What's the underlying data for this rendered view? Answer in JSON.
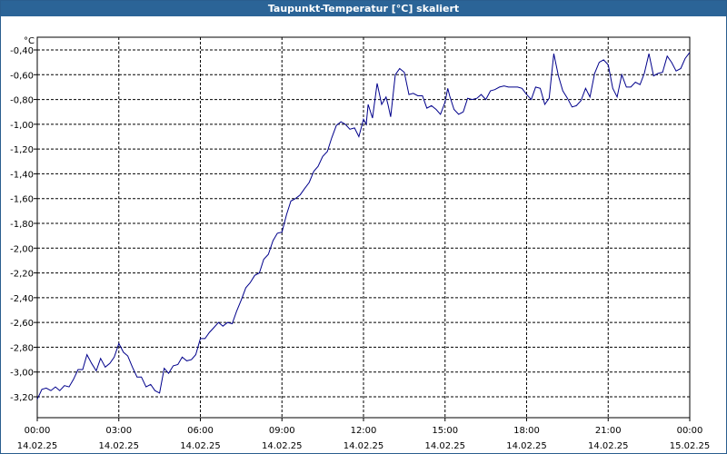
{
  "window": {
    "title": "Taupunkt-Temperatur [°C] skaliert"
  },
  "chart_data": {
    "type": "line",
    "title": "Taupunkt-Temperatur [°C] skaliert",
    "ylabel": "°C",
    "xlabel": "",
    "ylim": [
      -3.3,
      -0.3
    ],
    "xlim": [
      "14.02.25 00:00",
      "15.02.25 00:00"
    ],
    "grid": true,
    "line_color": "#00008b",
    "y_ticks": [
      "-0,40",
      "-0,60",
      "-0,80",
      "-1,00",
      "-1,20",
      "-1,40",
      "-1,60",
      "-1,80",
      "-2,00",
      "-2,20",
      "-2,40",
      "-2,60",
      "-2,80",
      "-3,00",
      "-3,20"
    ],
    "y_tick_values": [
      -0.4,
      -0.6,
      -0.8,
      -1.0,
      -1.2,
      -1.4,
      -1.6,
      -1.8,
      -2.0,
      -2.2,
      -2.4,
      -2.6,
      -2.8,
      -3.0,
      -3.2
    ],
    "x_ticks": [
      {
        "time": "00:00",
        "date": "14.02.25",
        "hour": 0
      },
      {
        "time": "03:00",
        "date": "14.02.25",
        "hour": 3
      },
      {
        "time": "06:00",
        "date": "14.02.25",
        "hour": 6
      },
      {
        "time": "09:00",
        "date": "14.02.25",
        "hour": 9
      },
      {
        "time": "12:00",
        "date": "14.02.25",
        "hour": 12
      },
      {
        "time": "15:00",
        "date": "14.02.25",
        "hour": 15
      },
      {
        "time": "18:00",
        "date": "14.02.25",
        "hour": 18
      },
      {
        "time": "21:00",
        "date": "14.02.25",
        "hour": 21
      },
      {
        "time": "00:00",
        "date": "15.02.25",
        "hour": 24
      }
    ],
    "series": [
      {
        "points": [
          [
            0.0,
            -3.22
          ],
          [
            0.17,
            -3.14
          ],
          [
            0.33,
            -3.13
          ],
          [
            0.5,
            -3.15
          ],
          [
            0.67,
            -3.12
          ],
          [
            0.83,
            -3.15
          ],
          [
            1.0,
            -3.11
          ],
          [
            1.17,
            -3.12
          ],
          [
            1.33,
            -3.06
          ],
          [
            1.5,
            -2.98
          ],
          [
            1.67,
            -2.98
          ],
          [
            1.83,
            -2.86
          ],
          [
            2.0,
            -2.93
          ],
          [
            2.17,
            -2.99
          ],
          [
            2.33,
            -2.89
          ],
          [
            2.5,
            -2.96
          ],
          [
            2.67,
            -2.93
          ],
          [
            2.83,
            -2.88
          ],
          [
            3.0,
            -2.77
          ],
          [
            3.17,
            -2.84
          ],
          [
            3.33,
            -2.87
          ],
          [
            3.5,
            -2.96
          ],
          [
            3.67,
            -3.04
          ],
          [
            3.83,
            -3.04
          ],
          [
            4.0,
            -3.12
          ],
          [
            4.17,
            -3.1
          ],
          [
            4.33,
            -3.15
          ],
          [
            4.5,
            -3.17
          ],
          [
            4.67,
            -2.97
          ],
          [
            4.83,
            -3.01
          ],
          [
            5.0,
            -2.95
          ],
          [
            5.17,
            -2.94
          ],
          [
            5.33,
            -2.88
          ],
          [
            5.5,
            -2.91
          ],
          [
            5.67,
            -2.9
          ],
          [
            5.83,
            -2.86
          ],
          [
            6.0,
            -2.73
          ],
          [
            6.17,
            -2.73
          ],
          [
            6.33,
            -2.68
          ],
          [
            6.5,
            -2.64
          ],
          [
            6.67,
            -2.6
          ],
          [
            6.83,
            -2.63
          ],
          [
            7.0,
            -2.6
          ],
          [
            7.17,
            -2.61
          ],
          [
            7.33,
            -2.51
          ],
          [
            7.5,
            -2.42
          ],
          [
            7.67,
            -2.32
          ],
          [
            7.83,
            -2.28
          ],
          [
            8.0,
            -2.22
          ],
          [
            8.17,
            -2.2
          ],
          [
            8.33,
            -2.09
          ],
          [
            8.5,
            -2.05
          ],
          [
            8.67,
            -1.94
          ],
          [
            8.83,
            -1.88
          ],
          [
            9.0,
            -1.87
          ],
          [
            9.17,
            -1.73
          ],
          [
            9.33,
            -1.62
          ],
          [
            9.5,
            -1.6
          ],
          [
            9.67,
            -1.57
          ],
          [
            9.83,
            -1.52
          ],
          [
            10.0,
            -1.47
          ],
          [
            10.17,
            -1.38
          ],
          [
            10.33,
            -1.34
          ],
          [
            10.5,
            -1.26
          ],
          [
            10.67,
            -1.22
          ],
          [
            10.83,
            -1.11
          ],
          [
            11.0,
            -1.01
          ],
          [
            11.17,
            -0.98
          ],
          [
            11.33,
            -1.0
          ],
          [
            11.5,
            -1.04
          ],
          [
            11.67,
            -1.03
          ],
          [
            11.83,
            -1.1
          ],
          [
            12.0,
            -0.96
          ],
          [
            12.1,
            -1.0
          ],
          [
            12.17,
            -0.84
          ],
          [
            12.33,
            -0.95
          ],
          [
            12.5,
            -0.67
          ],
          [
            12.67,
            -0.84
          ],
          [
            12.83,
            -0.78
          ],
          [
            12.9,
            -0.84
          ],
          [
            13.0,
            -0.94
          ],
          [
            13.17,
            -0.6
          ],
          [
            13.33,
            -0.55
          ],
          [
            13.5,
            -0.58
          ],
          [
            13.67,
            -0.76
          ],
          [
            13.83,
            -0.75
          ],
          [
            14.0,
            -0.77
          ],
          [
            14.17,
            -0.77
          ],
          [
            14.33,
            -0.87
          ],
          [
            14.5,
            -0.85
          ],
          [
            14.67,
            -0.88
          ],
          [
            14.83,
            -0.92
          ],
          [
            15.0,
            -0.82
          ],
          [
            15.1,
            -0.71
          ],
          [
            15.17,
            -0.77
          ],
          [
            15.33,
            -0.88
          ],
          [
            15.5,
            -0.92
          ],
          [
            15.67,
            -0.9
          ],
          [
            15.83,
            -0.79
          ],
          [
            16.0,
            -0.8
          ],
          [
            16.17,
            -0.79
          ],
          [
            16.33,
            -0.76
          ],
          [
            16.5,
            -0.8
          ],
          [
            16.67,
            -0.73
          ],
          [
            16.83,
            -0.72
          ],
          [
            17.0,
            -0.7
          ],
          [
            17.17,
            -0.69
          ],
          [
            17.33,
            -0.7
          ],
          [
            17.5,
            -0.7
          ],
          [
            17.67,
            -0.7
          ],
          [
            17.83,
            -0.71
          ],
          [
            18.0,
            -0.76
          ],
          [
            18.17,
            -0.8
          ],
          [
            18.33,
            -0.7
          ],
          [
            18.5,
            -0.71
          ],
          [
            18.67,
            -0.84
          ],
          [
            18.83,
            -0.79
          ],
          [
            19.0,
            -0.43
          ],
          [
            19.17,
            -0.61
          ],
          [
            19.33,
            -0.73
          ],
          [
            19.5,
            -0.79
          ],
          [
            19.67,
            -0.86
          ],
          [
            19.83,
            -0.85
          ],
          [
            20.0,
            -0.81
          ],
          [
            20.17,
            -0.71
          ],
          [
            20.33,
            -0.78
          ],
          [
            20.5,
            -0.59
          ],
          [
            20.67,
            -0.5
          ],
          [
            20.83,
            -0.48
          ],
          [
            21.0,
            -0.52
          ],
          [
            21.17,
            -0.71
          ],
          [
            21.33,
            -0.78
          ],
          [
            21.5,
            -0.6
          ],
          [
            21.67,
            -0.7
          ],
          [
            21.83,
            -0.7
          ],
          [
            22.0,
            -0.66
          ],
          [
            22.17,
            -0.68
          ],
          [
            22.33,
            -0.59
          ],
          [
            22.5,
            -0.43
          ],
          [
            22.67,
            -0.61
          ],
          [
            22.83,
            -0.59
          ],
          [
            23.0,
            -0.58
          ],
          [
            23.17,
            -0.45
          ],
          [
            23.33,
            -0.5
          ],
          [
            23.5,
            -0.57
          ],
          [
            23.67,
            -0.55
          ],
          [
            23.83,
            -0.47
          ],
          [
            24.0,
            -0.42
          ]
        ]
      }
    ]
  }
}
